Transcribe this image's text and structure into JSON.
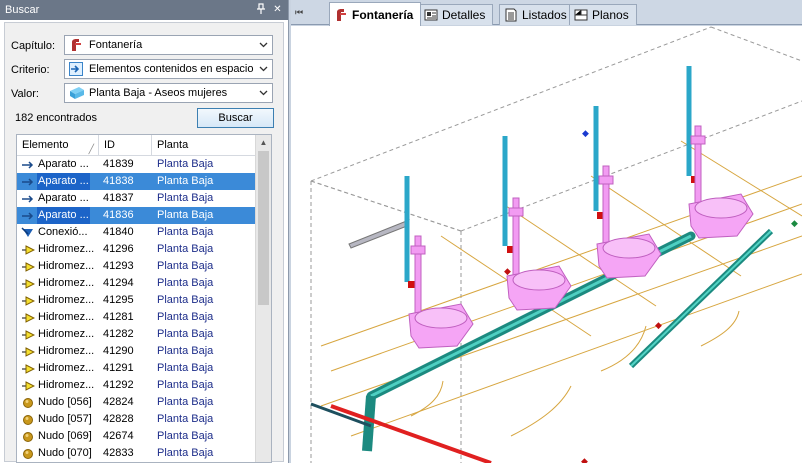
{
  "panel": {
    "title": "Buscar",
    "chapter_label": "Capítulo:",
    "chapter_value": "Fontanería",
    "criterion_label": "Criterio:",
    "criterion_value": "Elementos contenidos en espacio",
    "value_label": "Valor:",
    "value_value": "Planta Baja - Aseos mujeres",
    "found_text": "182 encontrados",
    "search_button": "Buscar"
  },
  "table": {
    "columns": [
      "Elemento",
      "ID",
      "Planta"
    ],
    "rows": [
      {
        "icon": "arrow-icon",
        "element": "Aparato ...",
        "id": "41839",
        "floor": "Planta Baja",
        "selected": false
      },
      {
        "icon": "arrow-icon",
        "element": "Aparato ...",
        "id": "41838",
        "floor": "Planta Baja",
        "selected": true
      },
      {
        "icon": "arrow-icon",
        "element": "Aparato ...",
        "id": "41837",
        "floor": "Planta Baja",
        "selected": false
      },
      {
        "icon": "arrow-icon",
        "element": "Aparato ...",
        "id": "41836",
        "floor": "Planta Baja",
        "selected": true
      },
      {
        "icon": "connection-icon",
        "element": "Conexió...",
        "id": "41840",
        "floor": "Planta Baja",
        "selected": false
      },
      {
        "icon": "hydrometer-icon",
        "element": "Hidromez...",
        "id": "41296",
        "floor": "Planta Baja",
        "selected": false
      },
      {
        "icon": "hydrometer-icon",
        "element": "Hidromez...",
        "id": "41293",
        "floor": "Planta Baja",
        "selected": false
      },
      {
        "icon": "hydrometer-icon",
        "element": "Hidromez...",
        "id": "41294",
        "floor": "Planta Baja",
        "selected": false
      },
      {
        "icon": "hydrometer-icon",
        "element": "Hidromez...",
        "id": "41295",
        "floor": "Planta Baja",
        "selected": false
      },
      {
        "icon": "hydrometer-icon",
        "element": "Hidromez...",
        "id": "41281",
        "floor": "Planta Baja",
        "selected": false
      },
      {
        "icon": "hydrometer-icon",
        "element": "Hidromez...",
        "id": "41282",
        "floor": "Planta Baja",
        "selected": false
      },
      {
        "icon": "hydrometer-icon",
        "element": "Hidromez...",
        "id": "41290",
        "floor": "Planta Baja",
        "selected": false
      },
      {
        "icon": "hydrometer-icon",
        "element": "Hidromez...",
        "id": "41291",
        "floor": "Planta Baja",
        "selected": false
      },
      {
        "icon": "hydrometer-icon",
        "element": "Hidromez...",
        "id": "41292",
        "floor": "Planta Baja",
        "selected": false
      },
      {
        "icon": "node-icon",
        "element": "Nudo [056]",
        "id": "42824",
        "floor": "Planta Baja",
        "selected": false
      },
      {
        "icon": "node-icon",
        "element": "Nudo [057]",
        "id": "42828",
        "floor": "Planta Baja",
        "selected": false
      },
      {
        "icon": "node-icon",
        "element": "Nudo [069]",
        "id": "42674",
        "floor": "Planta Baja",
        "selected": false
      },
      {
        "icon": "node-icon",
        "element": "Nudo [070]",
        "id": "42833",
        "floor": "Planta Baja",
        "selected": false
      }
    ]
  },
  "tabs": [
    {
      "label": "Fontanería",
      "icon": "plumbing-icon",
      "active": true
    },
    {
      "label": "Detalles",
      "icon": "details-icon",
      "active": false
    },
    {
      "label": "Listados",
      "icon": "list-icon",
      "active": false
    },
    {
      "label": "Planos",
      "icon": "plans-icon",
      "active": false
    }
  ],
  "colors": {
    "selection": "#3b8ad8",
    "fixture": "#f08cf0",
    "pipe": "#1e9a8c",
    "riser": "#2ba7c9",
    "hot_pipe": "#e02020"
  }
}
